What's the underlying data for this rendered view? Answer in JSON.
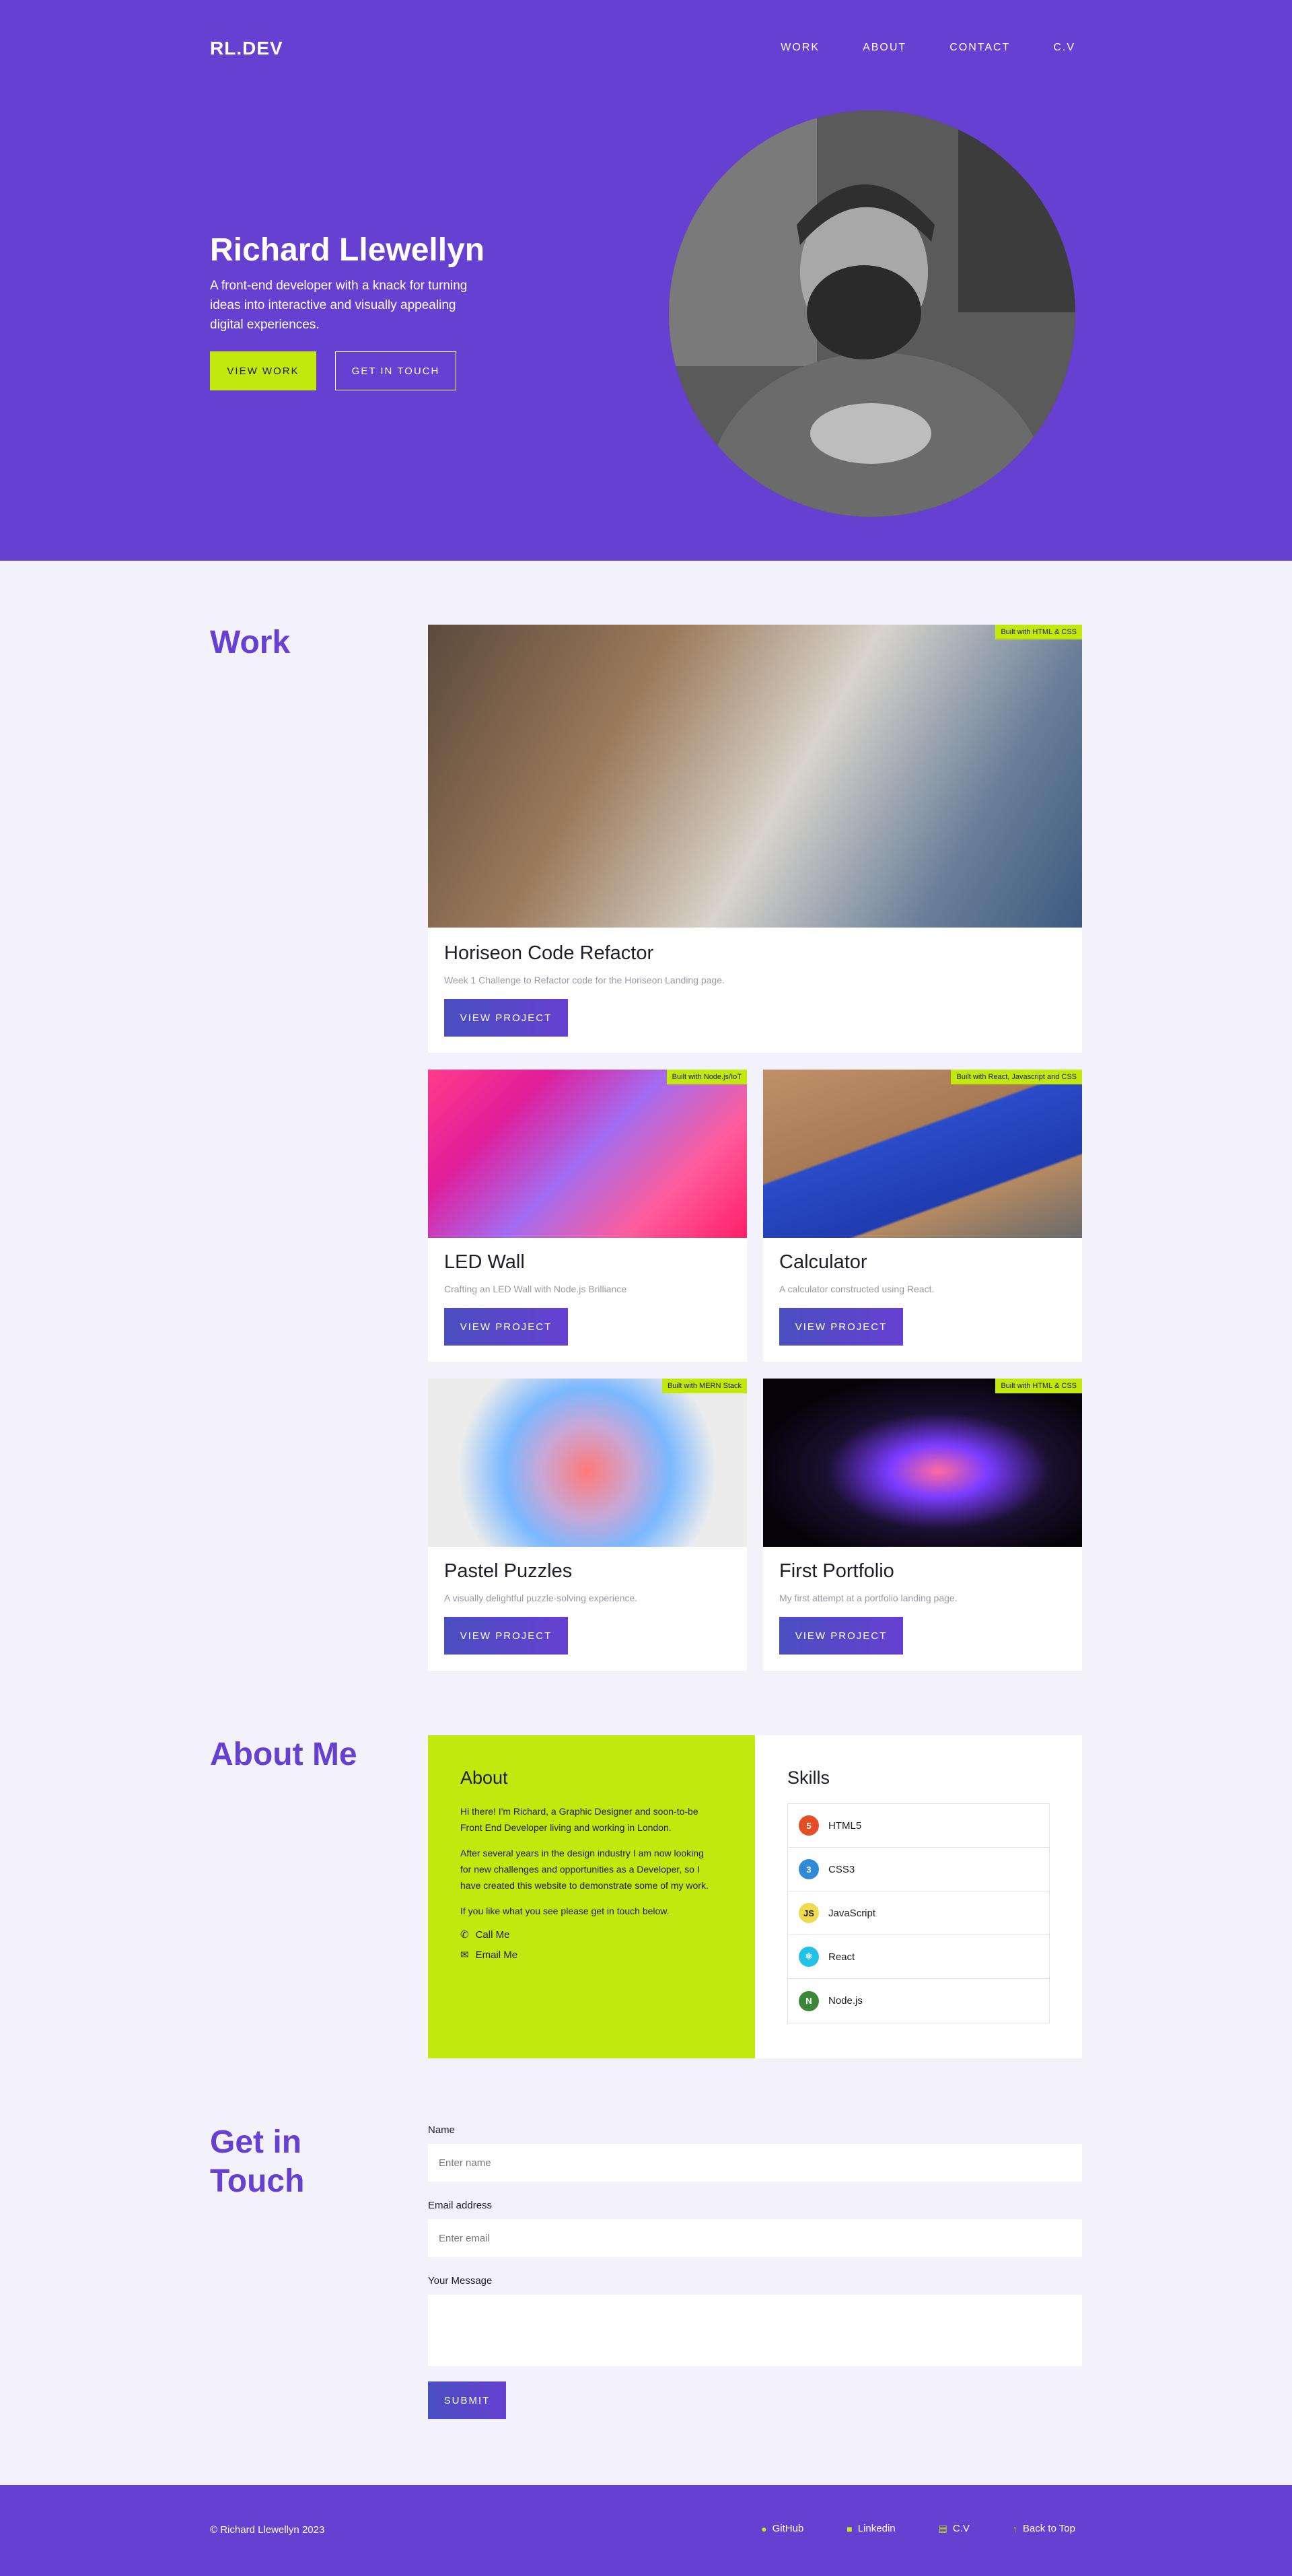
{
  "header": {
    "brand": "RL.DEV",
    "nav": [
      "WORK",
      "ABOUT",
      "CONTACT",
      "C.V"
    ]
  },
  "hero": {
    "name": "Richard Llewellyn",
    "tagline": "A front-end developer with a knack for turning ideas into interactive and visually appealing digital experiences.",
    "primary_button": "VIEW WORK",
    "secondary_button": "GET IN TOUCH"
  },
  "work": {
    "title": "Work",
    "projects": [
      {
        "title": "Horiseon Code Refactor",
        "description": "Week 1 Challenge to Refactor code for the Horiseon Landing page.",
        "badge": "Built with HTML & CSS",
        "button": "VIEW PROJECT"
      },
      {
        "title": "LED Wall",
        "description": "Crafting an LED Wall with Node.js Brilliance",
        "badge": "Built with Node.js/IoT",
        "button": "VIEW PROJECT"
      },
      {
        "title": "Calculator",
        "description": "A calculator constructed using React.",
        "badge": "Built with React, Javascript and CSS",
        "button": "VIEW PROJECT"
      },
      {
        "title": "Pastel Puzzles",
        "description": "A visually delightful puzzle-solving experience.",
        "badge": "Built with MERN Stack",
        "button": "VIEW PROJECT"
      },
      {
        "title": "First Portfolio",
        "description": "My first attempt at a portfolio landing page.",
        "badge": "Built with HTML & CSS",
        "button": "VIEW PROJECT"
      }
    ]
  },
  "about": {
    "title": "About Me",
    "heading": "About",
    "paragraphs": [
      "Hi there! I'm Richard, a Graphic Designer and soon-to-be Front End Developer living and working in London.",
      "After several years in the design industry I am now looking for new challenges and opportunities as a Developer, so I have created this website to demonstrate some of my work.",
      "If you like what you see please get in touch below."
    ],
    "call": "Call Me",
    "email": "Email Me",
    "skills_heading": "Skills",
    "skills": [
      {
        "name": "HTML5",
        "icon": "html5-icon",
        "color": "#e44d26",
        "glyph": "5"
      },
      {
        "name": "CSS3",
        "icon": "css3-icon",
        "color": "#2f8ad8",
        "glyph": "3"
      },
      {
        "name": "JavaScript",
        "icon": "javascript-icon",
        "color": "#f0db4f",
        "glyph": "JS"
      },
      {
        "name": "React",
        "icon": "react-icon",
        "color": "#22c2e8",
        "glyph": "⚛"
      },
      {
        "name": "Node.js",
        "icon": "nodejs-icon",
        "color": "#3c873a",
        "glyph": "N"
      }
    ]
  },
  "contact": {
    "title": "Get in Touch",
    "name_label": "Name",
    "name_placeholder": "Enter name",
    "email_label": "Email address",
    "email_placeholder": "Enter email",
    "message_label": "Your Message",
    "submit": "SUBMIT"
  },
  "footer": {
    "copyright": "© Richard Llewellyn 2023",
    "links": [
      "GitHub",
      "Linkedin",
      "C.V",
      "Back to Top"
    ]
  },
  "colors": {
    "primary": "#6640d1",
    "accent": "#c3e80d",
    "background": "#f3f2fb"
  }
}
